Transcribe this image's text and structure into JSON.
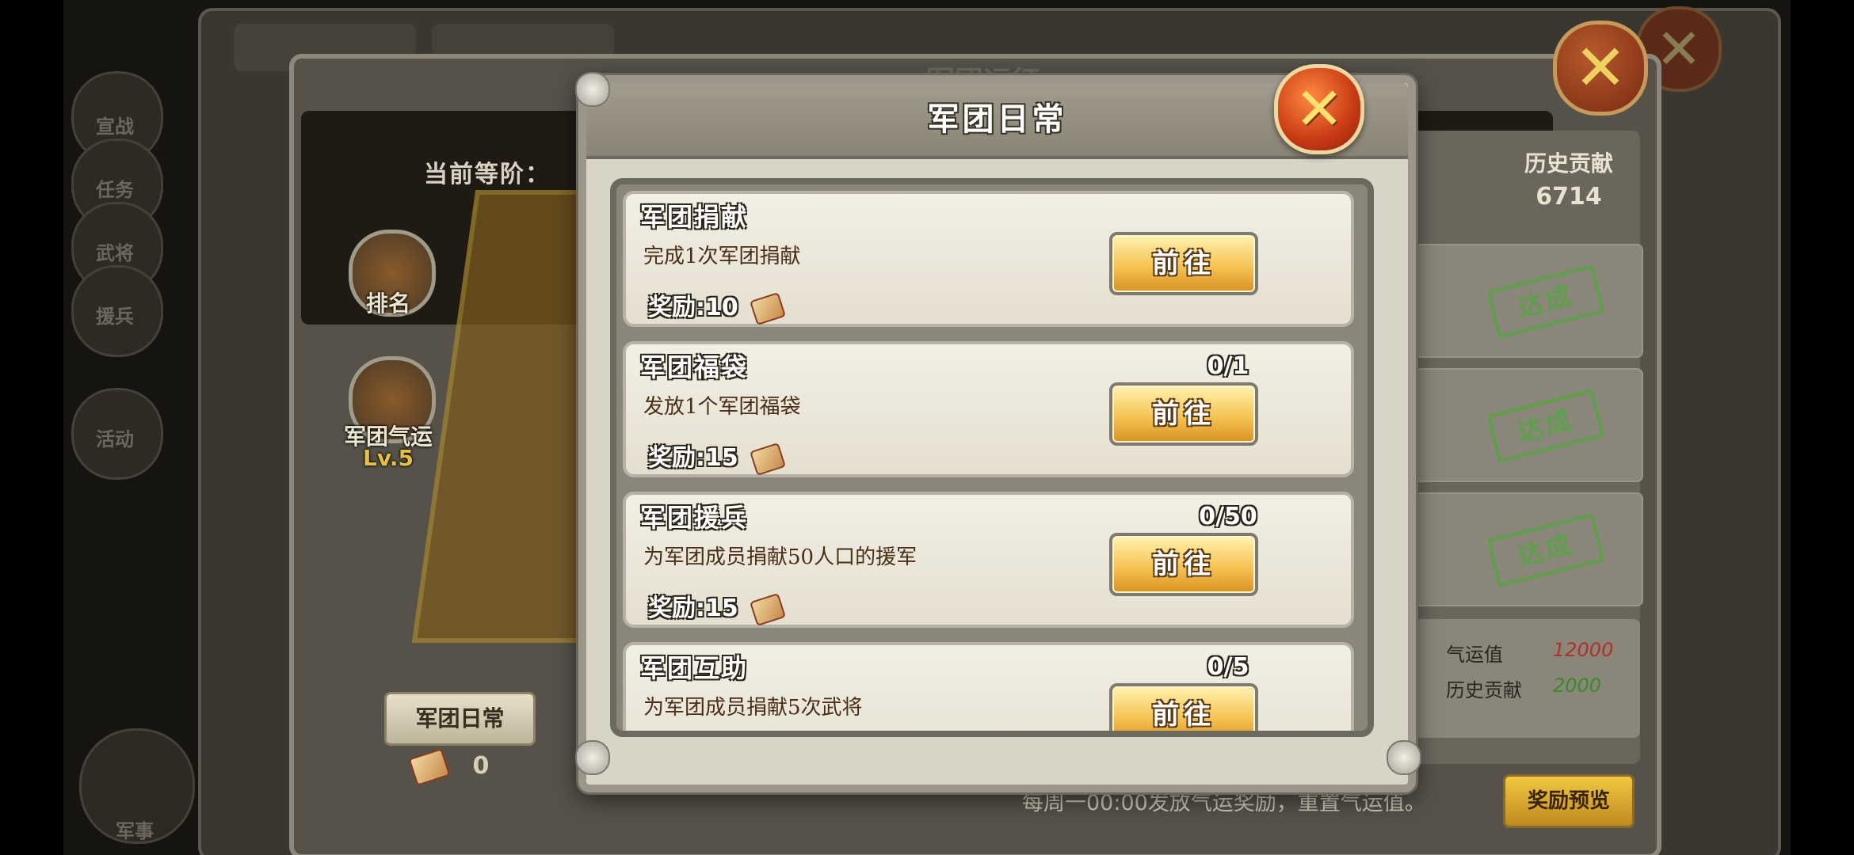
{
  "background": {
    "side_nav": [
      "宣战",
      "任务",
      "武将",
      "援兵",
      "活动",
      "军事"
    ],
    "close_icon": "close-x-icon"
  },
  "guild_panel": {
    "title": "军团远征",
    "current_rank_label": "当前等阶：",
    "ranking_label": "排名",
    "fortune_label": "军团气运",
    "fortune_level": "Lv.5",
    "history_contribution_label": "历史贡献",
    "history_contribution_value": "6714",
    "stamp_label": "达成",
    "fortune_value_label": "气运值",
    "fortune_value": "12000",
    "history_label": "历史贡献",
    "history_value": "2000",
    "daily_button": "军团日常",
    "coin_count": "0",
    "bottom_note": "每周一00:00发放气运奖励，重置气运值。",
    "preview_button": "奖励预览"
  },
  "modal": {
    "title": "军团日常",
    "close_icon": "close-x-icon",
    "tasks": [
      {
        "name": "军团捐献",
        "desc": "完成1次军团捐献",
        "reward": "奖励:10",
        "progress": "",
        "button": "前往"
      },
      {
        "name": "军团福袋",
        "desc": "发放1个军团福袋",
        "reward": "奖励:15",
        "progress": "0/1",
        "button": "前往"
      },
      {
        "name": "军团援兵",
        "desc": "为军团成员捐献50人口的援军",
        "reward": "奖励:15",
        "progress": "0/50",
        "button": "前往"
      },
      {
        "name": "军团互助",
        "desc": "为军团成员捐献5次武将",
        "reward": "",
        "progress": "0/5",
        "button": "前往"
      }
    ]
  },
  "colors": {
    "accent_gold": "#f6c454",
    "close_red": "#c83a14",
    "stamp_green": "#5ea04a",
    "fortune_red": "#b0302a",
    "history_green": "#3a8a2a"
  }
}
